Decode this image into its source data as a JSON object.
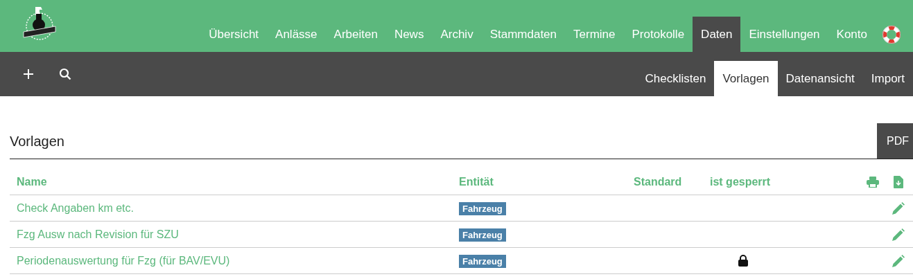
{
  "nav": [
    {
      "label": "Übersicht",
      "selected": false
    },
    {
      "label": "Anlässe",
      "selected": false
    },
    {
      "label": "Arbeiten",
      "selected": false
    },
    {
      "label": "News",
      "selected": false
    },
    {
      "label": "Archiv",
      "selected": false
    },
    {
      "label": "Stammdaten",
      "selected": false
    },
    {
      "label": "Termine",
      "selected": false
    },
    {
      "label": "Protokolle",
      "selected": false
    },
    {
      "label": "Daten",
      "selected": true
    },
    {
      "label": "Einstellungen",
      "selected": false
    },
    {
      "label": "Konto",
      "selected": false
    }
  ],
  "subnav": [
    {
      "label": "Checklisten",
      "selected": false
    },
    {
      "label": "Vorlagen",
      "selected": true
    },
    {
      "label": "Datenansicht",
      "selected": false
    },
    {
      "label": "Import",
      "selected": false
    }
  ],
  "section": {
    "title": "Vorlagen",
    "pdf_button": "PDF"
  },
  "table": {
    "columns": [
      "Name",
      "Entität",
      "Standard",
      "ist gesperrt"
    ],
    "rows": [
      {
        "name": "Check Angaben km etc.",
        "entity": "Fahrzeug",
        "locked": false
      },
      {
        "name": "Fzg Ausw nach Revision für SZU",
        "entity": "Fahrzeug",
        "locked": false
      },
      {
        "name": "Periodenauswertung für Fzg (für BAV/EVU)",
        "entity": "Fahrzeug",
        "locked": true
      }
    ]
  }
}
